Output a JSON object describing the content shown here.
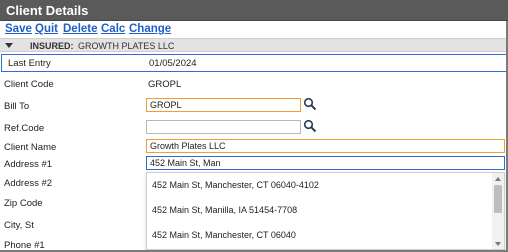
{
  "window": {
    "title": "Client Details"
  },
  "menu": {
    "save": "Save",
    "quit": "Quit",
    "delete": "Delete",
    "calc": "Calc",
    "change": "Change"
  },
  "insured": {
    "label": "INSURED:",
    "name": "GROWTH PLATES LLC"
  },
  "form": {
    "last_entry_label": "Last Entry",
    "last_entry_value": "01/05/2024",
    "client_code_label": "Client Code",
    "client_code_value": "GROPL",
    "bill_to_label": "Bill To",
    "bill_to_value": "GROPL",
    "ref_code_label": "Ref.Code",
    "ref_code_value": "",
    "client_name_label": "Client Name",
    "client_name_value": "Growth Plates LLC",
    "address1_label": "Address #1",
    "address1_value": "452 Main St, Man",
    "address2_label": "Address #2",
    "zip_label": "Zip Code",
    "city_label": "City, St",
    "phone1_label": "Phone #1"
  },
  "suggestions": [
    "452 Main St, Manchester, CT 06040-4102",
    "452 Main St, Manilla, IA 51454-7708",
    "452 Main St, Manchester, CT 06040"
  ],
  "colors": {
    "titlebar": "#5a5a5a",
    "link": "#1f5fc7",
    "focus": "#2e6fd6",
    "highlight": "#f0a030"
  }
}
